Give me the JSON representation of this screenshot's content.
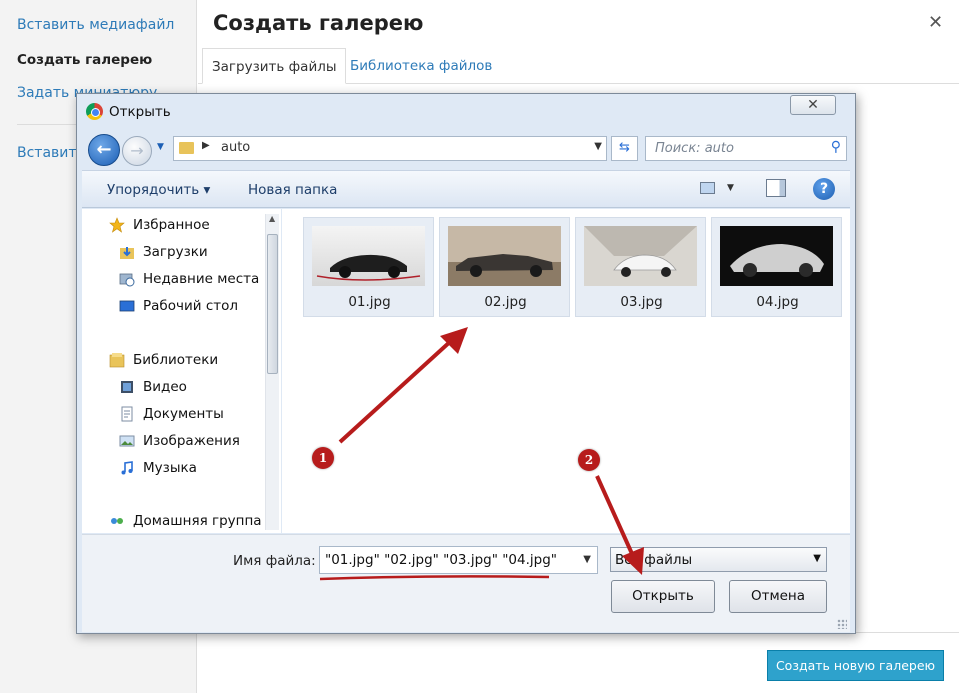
{
  "wp": {
    "sidebar": {
      "items": [
        {
          "label": "Вставить медиафайл"
        },
        {
          "label": "Создать галерею"
        },
        {
          "label": "Задать миниатюру"
        },
        {
          "label": "Вставить"
        }
      ]
    },
    "title": "Создать галерею",
    "close_glyph": "✕",
    "tabs": [
      {
        "label": "Загрузить файлы"
      },
      {
        "label": "Библиотека файлов"
      }
    ],
    "create_button": "Создать новую галерею"
  },
  "dialog": {
    "title": "Открыть",
    "close_glyph": "✕",
    "address": {
      "path": "auto"
    },
    "search": {
      "placeholder": "Поиск: auto"
    },
    "toolbar": {
      "organize": "Упорядочить ▾",
      "new_folder": "Новая папка",
      "help_glyph": "?"
    },
    "nav": {
      "favorites_label": "Избранное",
      "downloads": "Загрузки",
      "recent": "Недавние места",
      "desktop": "Рабочий стол",
      "libraries_label": "Библиотеки",
      "video": "Видео",
      "documents": "Документы",
      "images": "Изображения",
      "music": "Музыка",
      "homegroup": "Домашняя группа"
    },
    "files": [
      {
        "name": "01.jpg"
      },
      {
        "name": "02.jpg"
      },
      {
        "name": "03.jpg"
      },
      {
        "name": "04.jpg"
      }
    ],
    "filename_label": "Имя файла:",
    "filename_value": "\"01.jpg\" \"02.jpg\" \"03.jpg\" \"04.jpg\"",
    "filetype_value": "Все файлы",
    "open_button": "Открыть",
    "cancel_button": "Отмена"
  },
  "annotations": {
    "step1": "1",
    "step2": "2",
    "color": "#b71c1c"
  }
}
